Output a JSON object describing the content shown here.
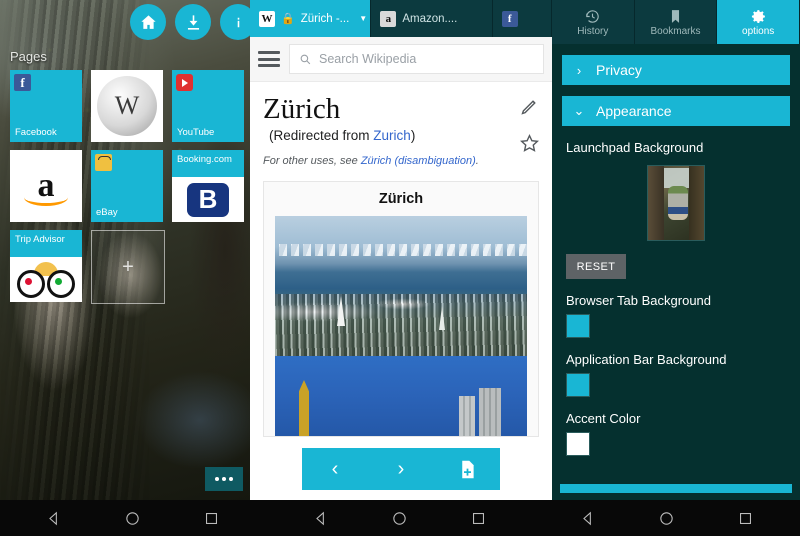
{
  "launchpad": {
    "buttons": [
      {
        "name": "home-button",
        "icon": "home-icon"
      },
      {
        "name": "download-button",
        "icon": "download-icon"
      },
      {
        "name": "info-button",
        "icon": "info-icon"
      }
    ],
    "pages_label": "Pages",
    "tiles": [
      {
        "label": "Facebook",
        "icon": "facebook-icon",
        "style": "cyan-bottom"
      },
      {
        "label": "",
        "icon": "wikipedia-globe-icon",
        "style": "white"
      },
      {
        "label": "YouTube",
        "icon": "youtube-icon",
        "style": "cyan-bottom"
      },
      {
        "label": "",
        "icon": "amazon-icon",
        "style": "white"
      },
      {
        "label": "eBay",
        "icon": "ebay-icon",
        "style": "cyan-bottom"
      },
      {
        "label": "Booking.com",
        "icon": "booking-icon",
        "style": "split"
      },
      {
        "label": "Trip Advisor",
        "icon": "tripadvisor-icon",
        "style": "split"
      }
    ],
    "add_tile_label": "+",
    "overflow_label": "•••"
  },
  "browser": {
    "tabs": [
      {
        "title": "Zürich -...",
        "favicon": "wikipedia-favicon",
        "secure": true,
        "active": true,
        "caret": "▼"
      },
      {
        "title": "Amazon....",
        "favicon": "amazon-favicon",
        "secure": false,
        "active": false
      },
      {
        "title": "",
        "favicon": "facebook-favicon",
        "secure": false,
        "active": false
      }
    ],
    "search_placeholder": "Search Wikipedia",
    "page": {
      "title": "Zürich",
      "redirect_prefix": "(Redirected from ",
      "redirect_link": "Zurich",
      "redirect_suffix": ")",
      "hatnote_prefix": "For other uses, see ",
      "hatnote_link": "Zürich (disambiguation)",
      "hatnote_suffix": ".",
      "infobox_title": "Zürich",
      "edit_icon": "pencil-icon",
      "star_icon": "star-icon"
    },
    "nav": {
      "back": "‹",
      "forward": "›",
      "newpage_icon": "new-page-icon"
    }
  },
  "options": {
    "tabs": [
      {
        "label": "History",
        "icon": "history-icon",
        "active": false
      },
      {
        "label": "Bookmarks",
        "icon": "bookmark-icon",
        "active": false
      },
      {
        "label": "options",
        "icon": "gear-icon",
        "active": true
      }
    ],
    "sections": [
      {
        "title": "Privacy",
        "arrow": "›",
        "expanded": false
      },
      {
        "title": "Appearance",
        "arrow": "⌄",
        "expanded": true
      }
    ],
    "launchpad_background_label": "Launchpad Background",
    "reset_label": "RESET",
    "color_settings": [
      {
        "label": "Browser Tab Background",
        "color": "#19b6d4"
      },
      {
        "label": "Application Bar Background",
        "color": "#19b6d4"
      },
      {
        "label": "Accent Color",
        "color": "#ffffff"
      }
    ]
  },
  "system": {
    "nav_icons": [
      "back-icon",
      "home-icon",
      "recents-icon"
    ]
  }
}
